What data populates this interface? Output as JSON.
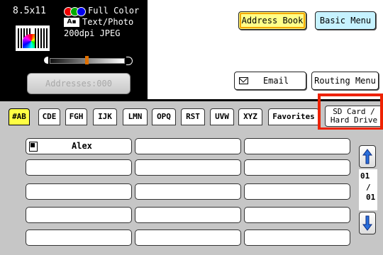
{
  "status": {
    "paper_size": "8.5x11",
    "color_mode": "Full Color",
    "scan_mode": "Text/Photo",
    "resolution": "200dpi JPEG",
    "scan_mode_icon": "text-photo-icon",
    "document_icon": "color-document-icon"
  },
  "addresses_button": "Addresses:000",
  "toolbar": {
    "address_book": "Address Book",
    "basic_menu": "Basic Menu",
    "email": "Email",
    "routing_menu": "Routing Menu"
  },
  "tabs": [
    {
      "label": "#AB"
    },
    {
      "label": "CDE"
    },
    {
      "label": "FGH"
    },
    {
      "label": "IJK"
    },
    {
      "label": "LMN"
    },
    {
      "label": "OPQ"
    },
    {
      "label": "RST"
    },
    {
      "label": "UVW"
    },
    {
      "label": "XYZ"
    },
    {
      "label": "Favorites"
    }
  ],
  "sd_tab": {
    "line1": "SD Card /",
    "line2": "Hard Drive"
  },
  "entries": [
    {
      "name": "Alex",
      "icon": "pc-icon"
    }
  ],
  "pager": {
    "current": "01",
    "separator": "/",
    "total": "01"
  },
  "colors": {
    "active_tab": "#ffff44",
    "address_book_bg": "#ffff88",
    "basic_menu_bg": "#c6f2ff",
    "highlight": "#ee2200",
    "panel_bg": "#c6c6c6"
  }
}
